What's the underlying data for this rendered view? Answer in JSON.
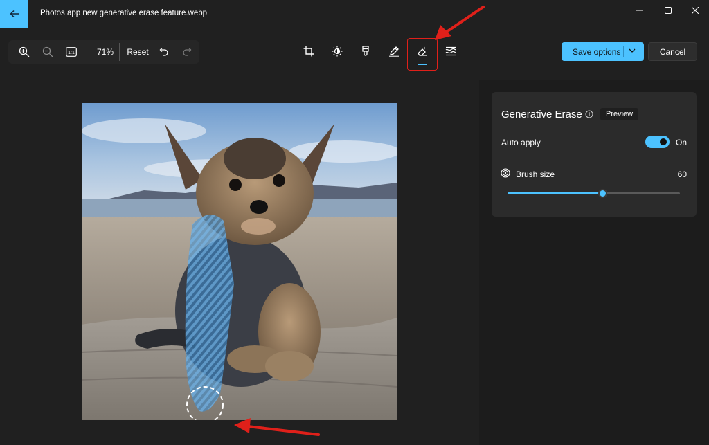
{
  "window": {
    "title": "Photos app new generative erase feature.webp",
    "accent": "#4cc2ff"
  },
  "toolbar": {
    "zoom_level": "71%",
    "reset_label": "Reset",
    "actual_size_glyph": "1:1",
    "tools": [
      "crop-icon",
      "adjust-brightness-icon",
      "filter-icon",
      "markup-pen-icon",
      "generative-erase-icon",
      "background-blur-icon"
    ],
    "active_tool": "generative-erase-icon",
    "save_label": "Save options",
    "cancel_label": "Cancel"
  },
  "panel": {
    "title": "Generative Erase",
    "badge": "Preview",
    "auto_apply_label": "Auto apply",
    "auto_apply_on": true,
    "auto_apply_state": "On",
    "brush_label": "Brush size",
    "brush_value": "60",
    "brush_fraction": 0.55
  },
  "annotations": {
    "highlight_color": "#e0201a"
  }
}
